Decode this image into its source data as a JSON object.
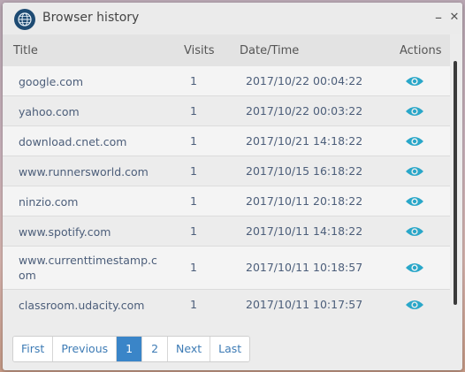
{
  "window": {
    "title": "Browser history",
    "minimize": "–",
    "close": "✕"
  },
  "table": {
    "headers": {
      "title": "Title",
      "visits": "Visits",
      "datetime": "Date/Time",
      "actions": "Actions"
    },
    "rows": [
      {
        "title": "google.com",
        "visits": "1",
        "datetime": "2017/10/22 00:04:22"
      },
      {
        "title": "yahoo.com",
        "visits": "1",
        "datetime": "2017/10/22 00:03:22"
      },
      {
        "title": "download.cnet.com",
        "visits": "1",
        "datetime": "2017/10/21 14:18:22"
      },
      {
        "title": "www.runnersworld.com",
        "visits": "1",
        "datetime": "2017/10/15 16:18:22"
      },
      {
        "title": "ninzio.com",
        "visits": "1",
        "datetime": "2017/10/11 20:18:22"
      },
      {
        "title": "www.spotify.com",
        "visits": "1",
        "datetime": "2017/10/11 14:18:22"
      },
      {
        "title": "www.currenttimestamp.com",
        "visits": "1",
        "datetime": "2017/10/11 10:18:57"
      },
      {
        "title": "classroom.udacity.com",
        "visits": "1",
        "datetime": "2017/10/11 10:17:57"
      }
    ],
    "action_icon": "eye-icon"
  },
  "pagination": {
    "first": "First",
    "previous": "Previous",
    "page1": "1",
    "page2": "2",
    "next": "Next",
    "last": "Last",
    "current_page": "1"
  },
  "colors": {
    "accent": "#3a85c8",
    "eye": "#2aa7c9",
    "link_text": "#4c5e7a"
  }
}
